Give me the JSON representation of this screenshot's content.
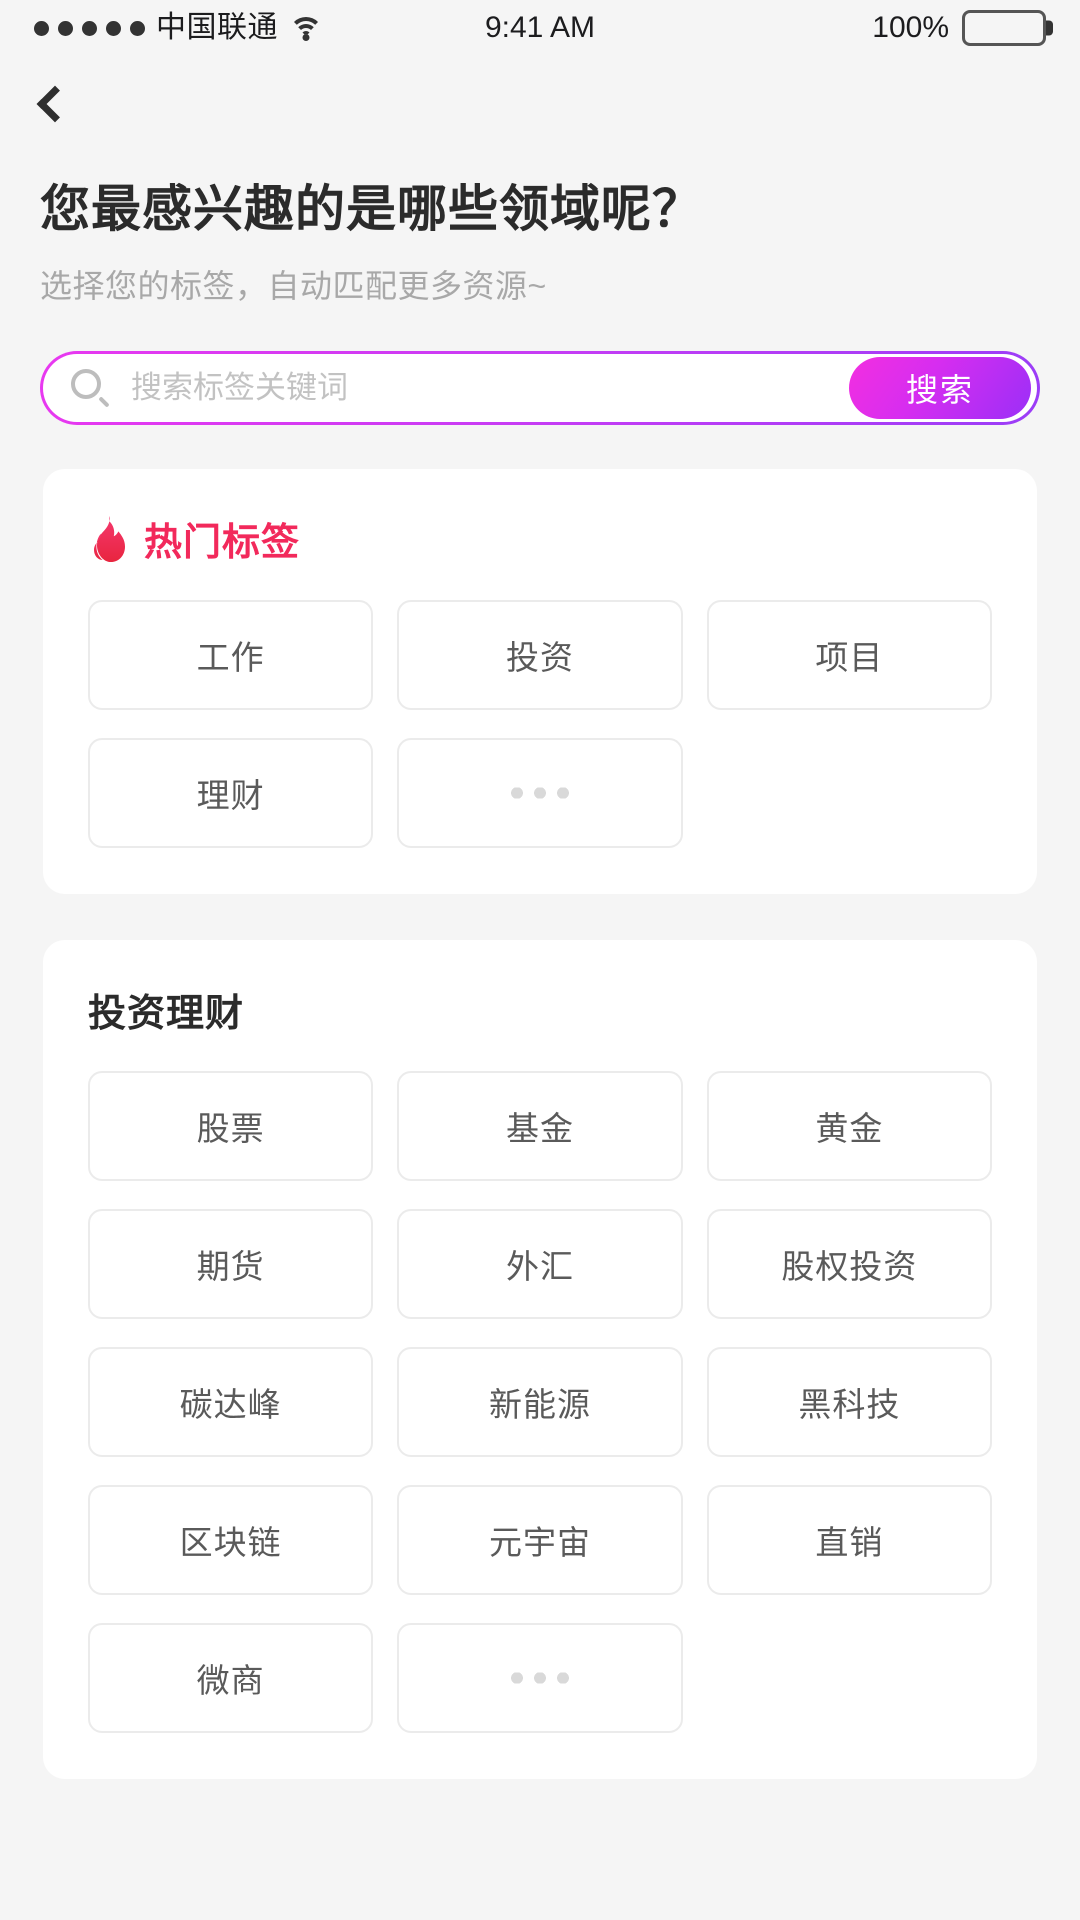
{
  "status_bar": {
    "signal_dots": 5,
    "carrier": "中国联通",
    "wifi_icon": "wifi-icon",
    "time": "9:41 AM",
    "battery_percent": "100%",
    "battery_icon": "battery-full-icon"
  },
  "nav": {
    "back_icon": "back-chevron-icon"
  },
  "heading": {
    "title": "您最感兴趣的是哪些领域呢？",
    "subtitle": "选择您的标签，自动匹配更多资源~"
  },
  "search": {
    "icon": "search-icon",
    "placeholder": "搜索标签关键词",
    "value": "",
    "button_label": "搜索",
    "border_gradient_from": "#e838f0",
    "border_gradient_to": "#9b3df7",
    "button_gradient_from": "#f32fe0",
    "button_gradient_to": "#9b2ff7"
  },
  "sections": [
    {
      "id": "hot-tags",
      "icon": "flame-icon",
      "title": "热门标签",
      "title_color": "#f2295b",
      "tags": [
        {
          "label": "工作",
          "more": false
        },
        {
          "label": "投资",
          "more": false
        },
        {
          "label": "项目",
          "more": false
        },
        {
          "label": "理财",
          "more": false
        },
        {
          "label": "•••",
          "more": true
        }
      ]
    },
    {
      "id": "investment",
      "icon": "",
      "title": "投资理财",
      "title_color": "#2b2b2b",
      "tags": [
        {
          "label": "股票",
          "more": false
        },
        {
          "label": "基金",
          "more": false
        },
        {
          "label": "黄金",
          "more": false
        },
        {
          "label": "期货",
          "more": false
        },
        {
          "label": "外汇",
          "more": false
        },
        {
          "label": "股权投资",
          "more": false
        },
        {
          "label": "碳达峰",
          "more": false
        },
        {
          "label": "新能源",
          "more": false
        },
        {
          "label": "黑科技",
          "more": false
        },
        {
          "label": "区块链",
          "more": false
        },
        {
          "label": "元宇宙",
          "more": false
        },
        {
          "label": "直销",
          "more": false
        },
        {
          "label": "微商",
          "more": false
        },
        {
          "label": "•••",
          "more": true
        }
      ]
    }
  ],
  "theme": {
    "page_bg": "#f5f5f5",
    "card_bg": "#ffffff",
    "chip_border": "#ebebeb",
    "chip_text": "#5a5a5a"
  }
}
